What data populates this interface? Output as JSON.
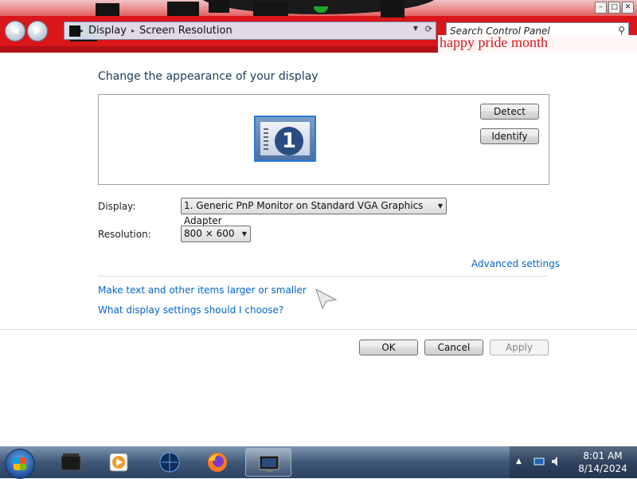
{
  "window": {
    "controls": {
      "minimize": "–",
      "maximize": "□",
      "close": "✕"
    }
  },
  "nav": {
    "back": "◀",
    "forward": "▶"
  },
  "address": {
    "crumbs": [
      "Display",
      "Screen Resolution"
    ],
    "separator": "▸"
  },
  "search": {
    "placeholder": "Search Control Panel",
    "icon": "search-icon"
  },
  "banner": {
    "text": "happy pride month"
  },
  "main": {
    "heading": "Change the appearance of your display",
    "monitor_number": "1",
    "detect_label": "Detect",
    "identify_label": "Identify",
    "display_label": "Display:",
    "display_value": "1. Generic PnP Monitor on Standard VGA Graphics Adapter",
    "resolution_label": "Resolution:",
    "resolution_value": "800 × 600",
    "advanced_link": "Advanced settings",
    "link_text_size": "Make text and other items larger or smaller",
    "link_choose": "What display settings should I choose?"
  },
  "footer": {
    "ok_label": "OK",
    "cancel_label": "Cancel",
    "apply_label": "Apply"
  },
  "taskbar": {
    "apps": [
      "terminal-icon",
      "media-player-icon",
      "globe-icon",
      "firefox-icon",
      "display-settings-icon"
    ],
    "clock_time": "8:01 AM",
    "clock_date": "8/14/2024"
  },
  "colors": {
    "link": "#0066cc",
    "heading": "#1e395b",
    "titlebar": "#d9171b"
  }
}
